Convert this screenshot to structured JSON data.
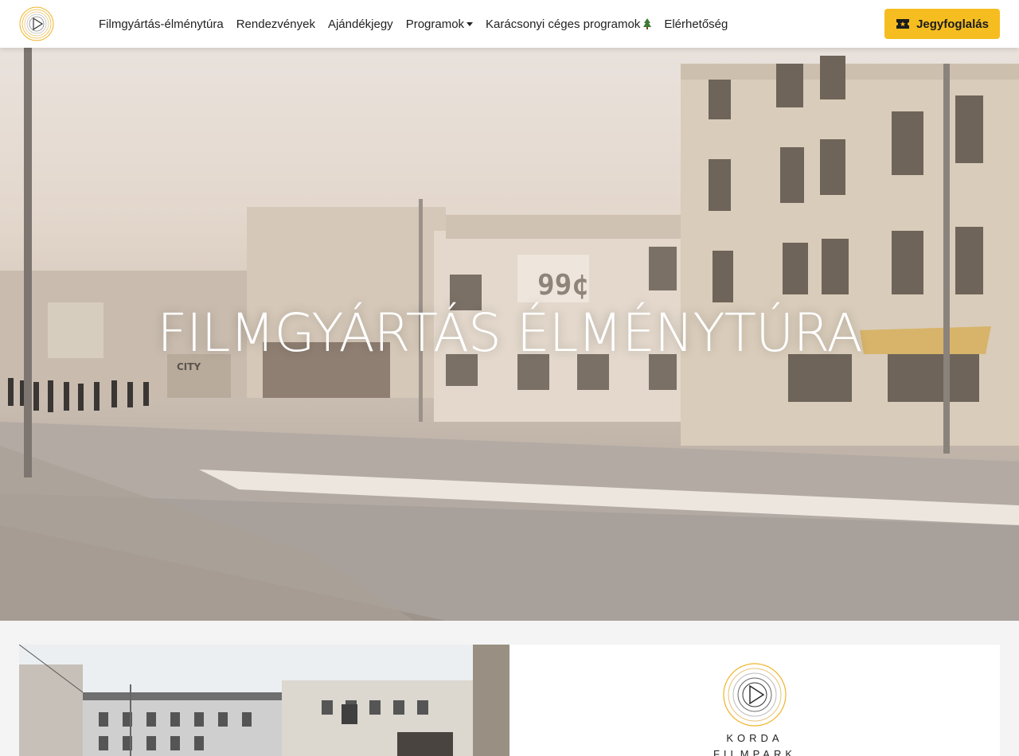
{
  "nav": {
    "items": [
      {
        "label": "Filmgyártás-élménytúra"
      },
      {
        "label": "Rendezvények"
      },
      {
        "label": "Ajándékjegy"
      },
      {
        "label": "Programok"
      },
      {
        "label": "Karácsonyi céges programok"
      },
      {
        "label": "Elérhetőség"
      }
    ],
    "book_button": "Jegyfoglalás"
  },
  "hero": {
    "title": "FILMGYÁRTÁS ÉLMÉNYTÚRA",
    "sign_99": "99¢",
    "sign_city": "CITY"
  },
  "brand": {
    "line1": "KORDA",
    "line2": "FILMPARK"
  },
  "colors": {
    "accent": "#f5bd1f",
    "logo_ring": "#f0b429"
  },
  "icons": {
    "logo": "play-circle-rings-icon",
    "caret": "chevron-down-icon",
    "tree": "christmas-tree-icon",
    "ticket": "ticket-icon"
  }
}
